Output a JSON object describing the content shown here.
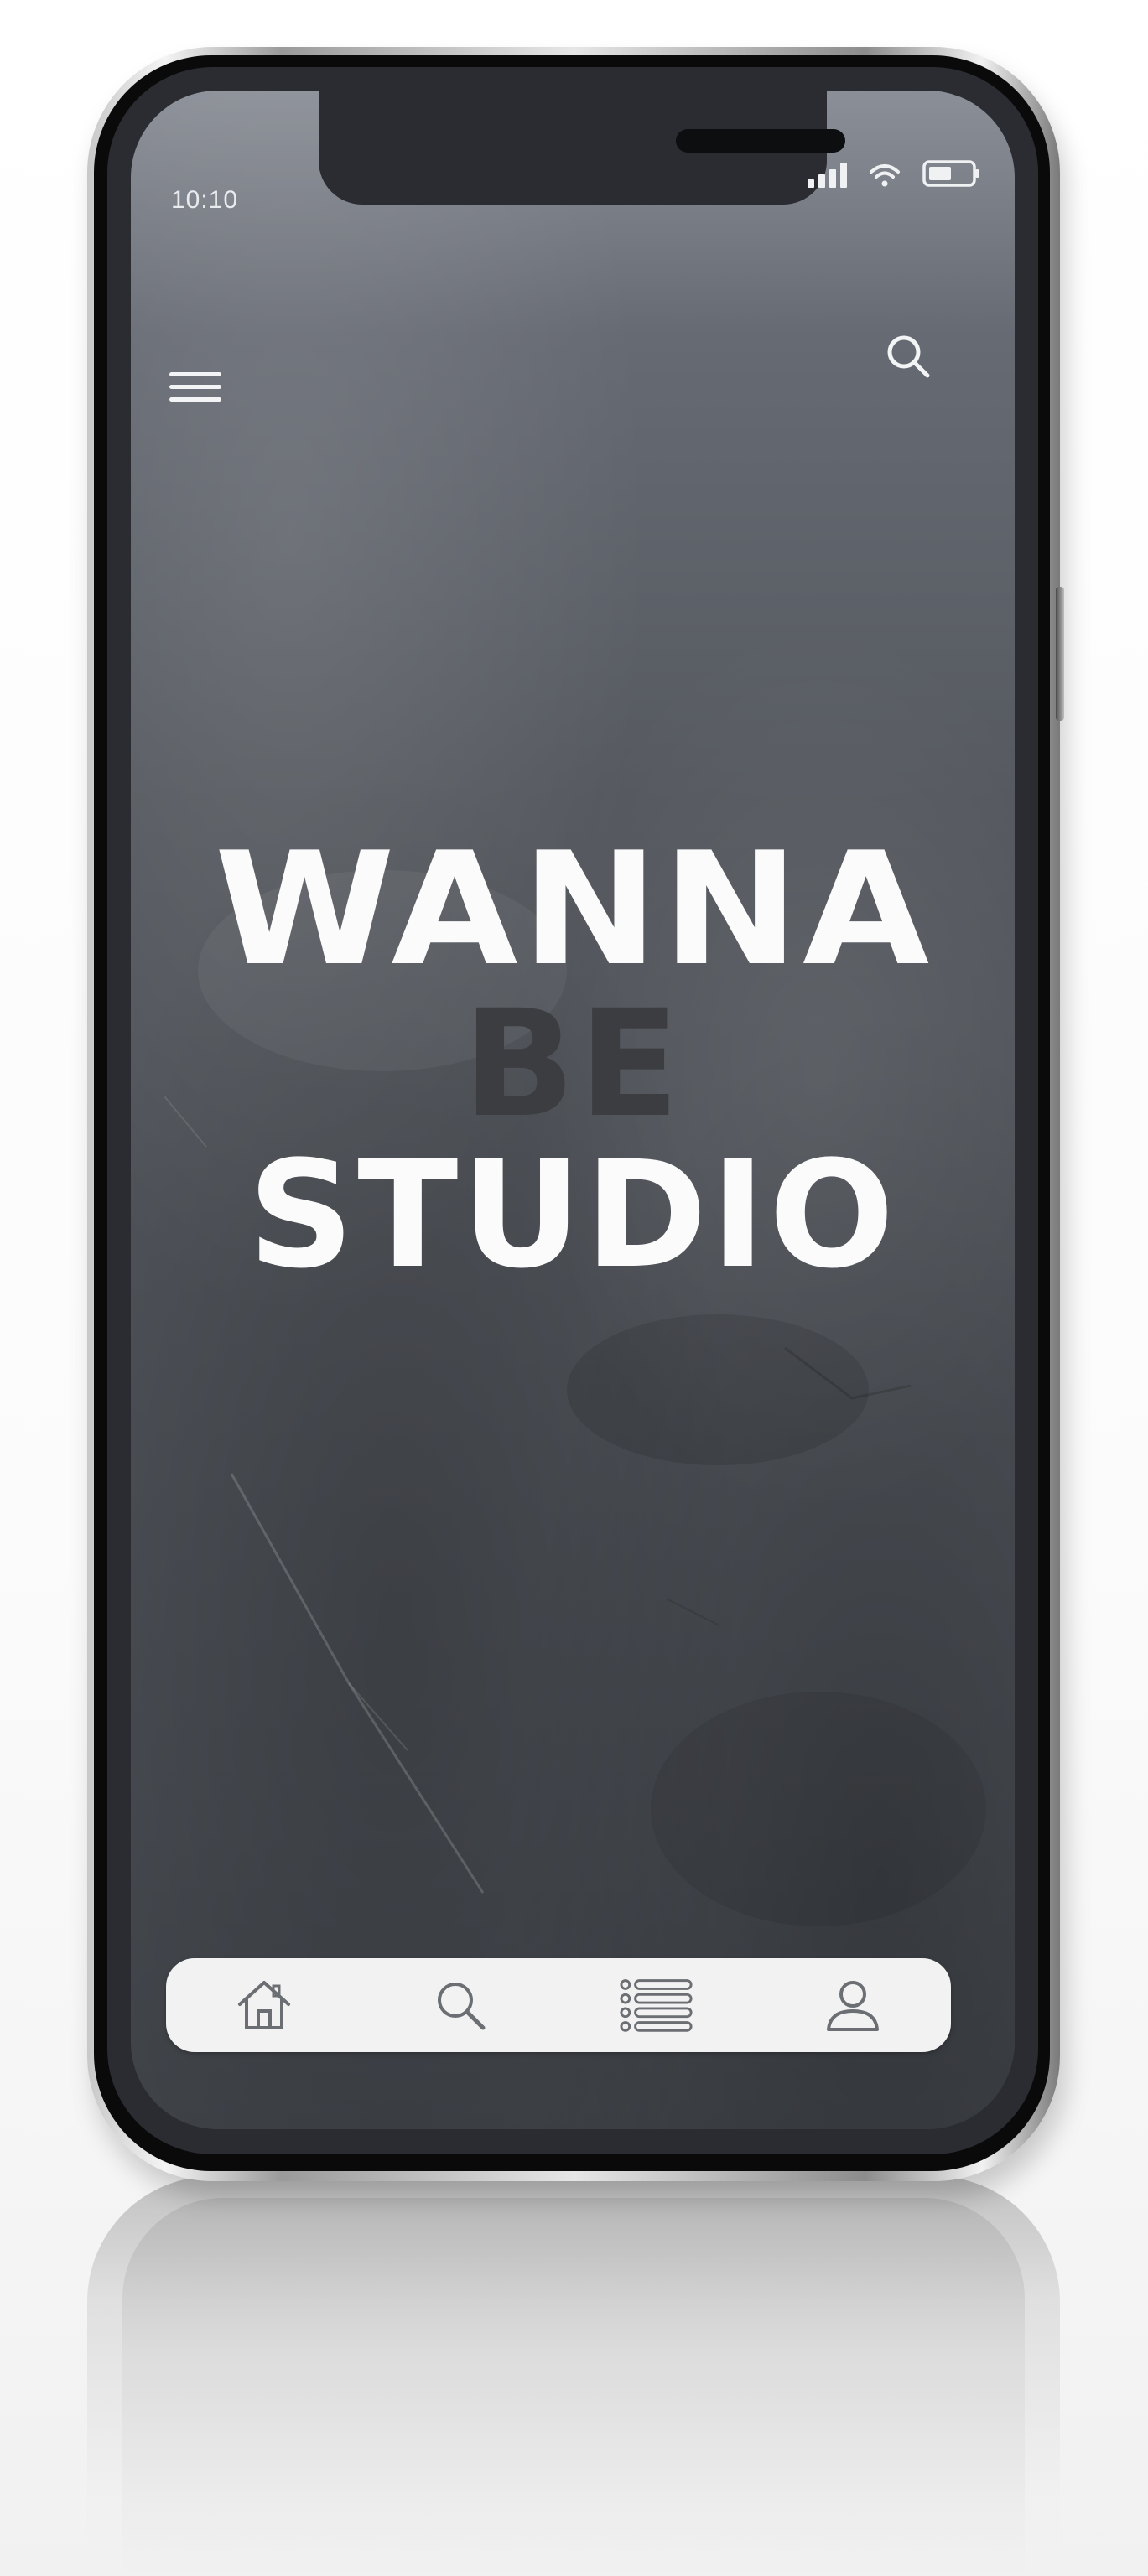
{
  "status_bar": {
    "time": "10:10"
  },
  "header": {
    "menu_icon": "hamburger-menu-icon",
    "search_icon": "search-icon"
  },
  "hero": {
    "line1": "WANNA",
    "line2": "BE",
    "line3": "STUDIO",
    "colors": {
      "primary": "#fbfbfb",
      "accent": "#3b3d41"
    }
  },
  "bottom_nav": {
    "items": [
      {
        "icon": "home-icon"
      },
      {
        "icon": "search-icon"
      },
      {
        "icon": "list-icon"
      },
      {
        "icon": "user-icon"
      }
    ]
  },
  "colors": {
    "screen_background": "#55595f",
    "nav_background": "#f2f2f2",
    "icon_color": "#6b6e73"
  }
}
